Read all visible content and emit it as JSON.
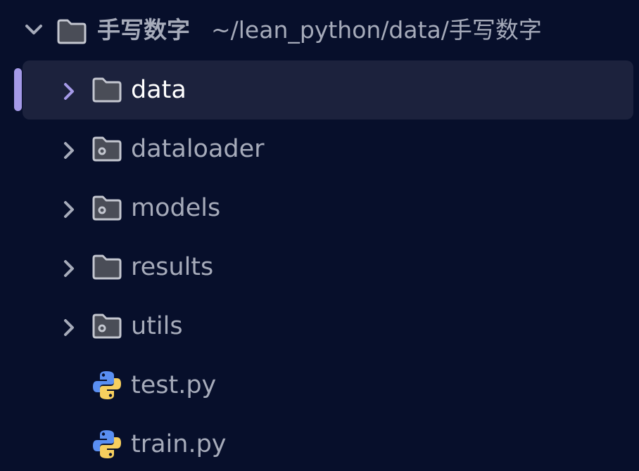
{
  "root": {
    "name": "手写数字",
    "path": "~/lean_python/data/手写数字",
    "expanded": true
  },
  "items": [
    {
      "label": "data",
      "type": "folder",
      "icon": "folder-icon",
      "selected": true
    },
    {
      "label": "dataloader",
      "type": "folder",
      "icon": "package-folder-icon",
      "selected": false
    },
    {
      "label": "models",
      "type": "folder",
      "icon": "package-folder-icon",
      "selected": false
    },
    {
      "label": "results",
      "type": "folder",
      "icon": "folder-icon",
      "selected": false
    },
    {
      "label": "utils",
      "type": "folder",
      "icon": "package-folder-icon",
      "selected": false
    },
    {
      "label": "test.py",
      "type": "file",
      "icon": "python-icon",
      "selected": false
    },
    {
      "label": "train.py",
      "type": "file",
      "icon": "python-icon",
      "selected": false
    }
  ],
  "colors": {
    "background": "#070f2b",
    "selected_row": "#1c223d",
    "selection_indicator": "#a59ae8",
    "text": "#a6abba",
    "selected_text": "#ffffff",
    "folder": "#4a4d57",
    "python_blue": "#5a8ff2",
    "python_yellow": "#f7cf5e"
  }
}
